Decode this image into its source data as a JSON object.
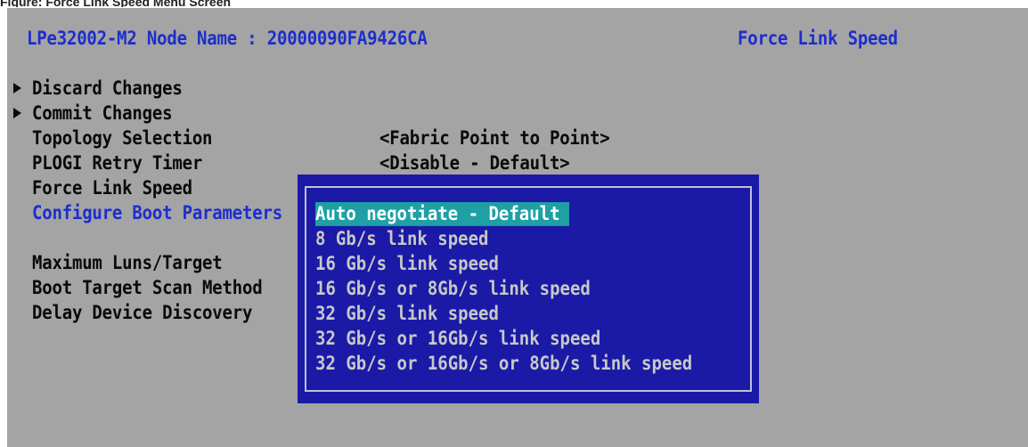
{
  "caption": "Figure: Force Link Speed Menu Screen",
  "header": {
    "node_line": "LPe32002-M2 Node Name : 20000090FA9426CA",
    "screen_title": "Force Link Speed"
  },
  "menu": {
    "discard": "Discard Changes",
    "commit": "Commit  Changes",
    "topology_label": "Topology Selection",
    "topology_value": "<Fabric Point to Point>",
    "plogi_label": "PLOGI Retry Timer",
    "plogi_value": "<Disable - Default>",
    "force_label": "Force Link Speed",
    "boot_label": "Configure Boot Parameters",
    "luns_label": "Maximum Luns/Target",
    "scan_label": "Boot Target Scan Method",
    "delay_label": "Delay Device Discovery"
  },
  "popup": {
    "selected": "Auto negotiate - Default",
    "options": [
      "Auto negotiate - Default",
      "8 Gb/s link speed",
      "16 Gb/s link speed",
      "16 Gb/s or 8Gb/s link speed",
      "32 Gb/s link speed",
      "32 Gb/s or 16Gb/s link speed",
      "32 Gb/s or 16Gb/s or 8Gb/s link speed"
    ]
  },
  "colors": {
    "background": "#a4a4a4",
    "popup_bg": "#1a1aa6",
    "highlight": "#1ea0a4",
    "accent_text": "#1d2ecc"
  }
}
